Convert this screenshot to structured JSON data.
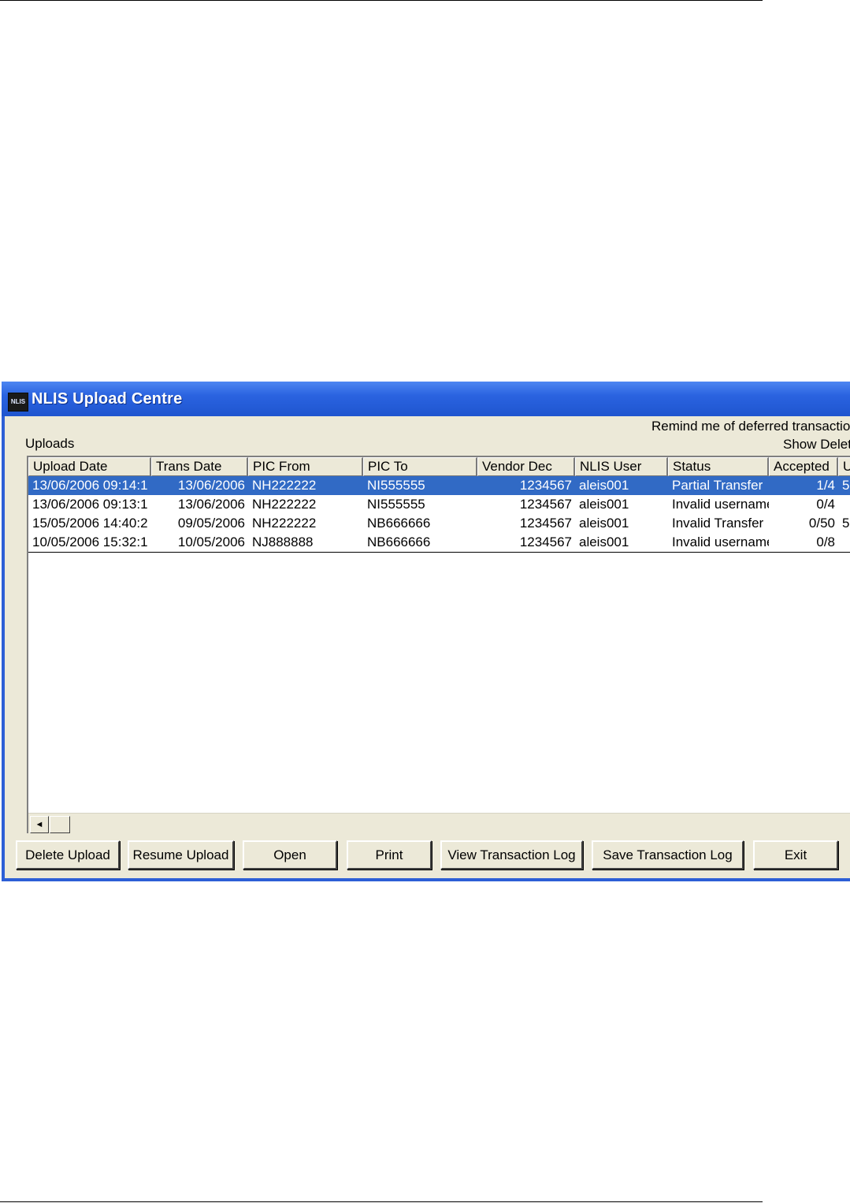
{
  "window": {
    "title": "NLIS Upload Centre",
    "icon_label": "NLIS"
  },
  "labels": {
    "remind": "Remind me of deferred transactions",
    "uploads": "Uploads",
    "show_deleted": "Show Delet"
  },
  "columns": [
    "Upload Date",
    "Trans Date",
    "PIC From",
    "PIC To",
    "Vendor Dec",
    "NLIS User",
    "Status",
    "Accepted",
    "U"
  ],
  "rows": [
    {
      "upload_date": "13/06/2006 09:14:1",
      "trans_date": "13/06/2006",
      "pic_from": "NH222222",
      "pic_to": "NI555555",
      "vendor_dec": "1234567",
      "nlis_user": "aleis001",
      "status": "Partial Transfer",
      "accepted": "1/4",
      "u": "5",
      "selected": true
    },
    {
      "upload_date": "13/06/2006 09:13:1",
      "trans_date": "13/06/2006",
      "pic_from": "NH222222",
      "pic_to": "NI555555",
      "vendor_dec": "1234567",
      "nlis_user": "aleis001",
      "status": "Invalid username",
      "accepted": "0/4",
      "u": "",
      "selected": false
    },
    {
      "upload_date": "15/05/2006 14:40:2",
      "trans_date": "09/05/2006",
      "pic_from": "NH222222",
      "pic_to": "NB666666",
      "vendor_dec": "1234567",
      "nlis_user": "aleis001",
      "status": "Invalid Transfer",
      "accepted": "0/50",
      "u": "5",
      "selected": false
    },
    {
      "upload_date": "10/05/2006 15:32:1",
      "trans_date": "10/05/2006",
      "pic_from": "NJ888888",
      "pic_to": "NB666666",
      "vendor_dec": "1234567",
      "nlis_user": "aleis001",
      "status": "Invalid username",
      "accepted": "0/8",
      "u": "",
      "selected": false
    }
  ],
  "scrollbar": {
    "left_arrow": "◄"
  },
  "buttons": {
    "delete_upload": "Delete Upload",
    "resume_upload": "Resume Upload",
    "open": "Open",
    "print": "Print",
    "view_log": "View Transaction Log",
    "save_log": "Save Transaction Log",
    "exit": "Exit"
  },
  "colors": {
    "title_bar": "#2a63e0",
    "selection": "#316ac5",
    "face": "#ece9d8"
  }
}
